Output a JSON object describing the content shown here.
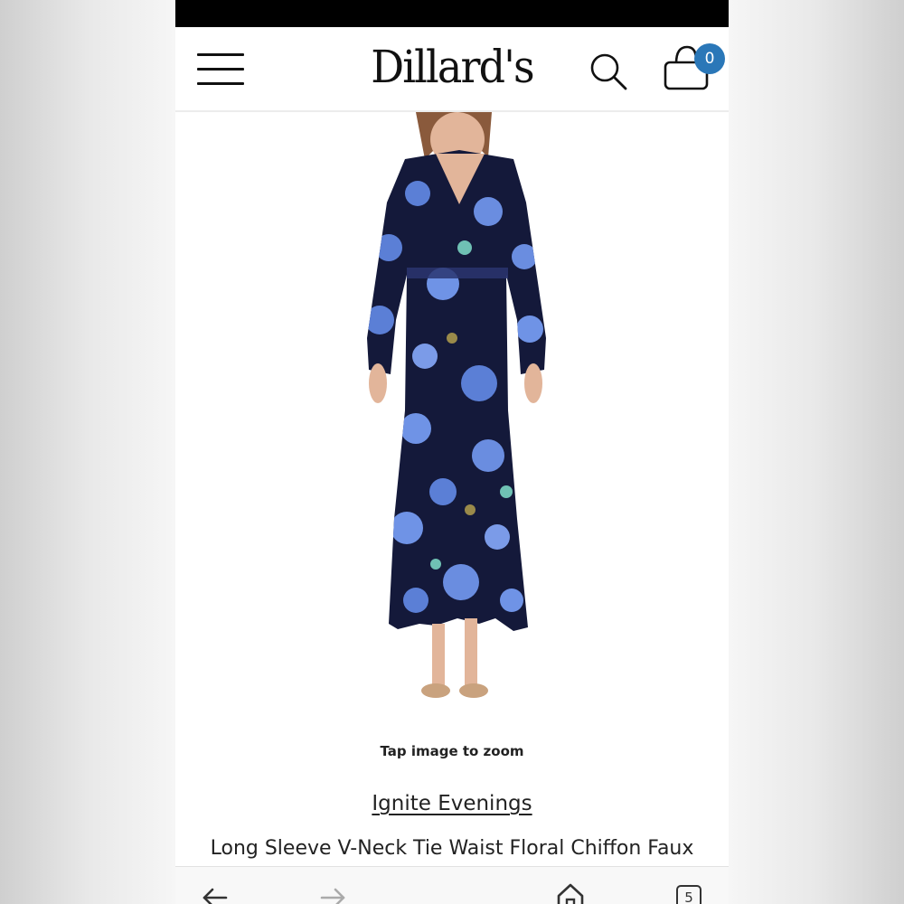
{
  "header": {
    "logo_text": "Dillard's",
    "cart_count": "0"
  },
  "product": {
    "image_hint": "Tap image to zoom",
    "brand": "Ignite Evenings",
    "title": "Long Sleeve V-Neck Tie Waist Floral Chiffon Faux"
  },
  "browser_toolbar": {
    "tab_count": "5"
  },
  "colors": {
    "accent_badge": "#2a77b8",
    "dress_navy": "#14193a",
    "flower_blue": "#5b7fd6"
  },
  "icons": [
    "menu-icon",
    "search-icon",
    "shopping-bag-icon",
    "back-arrow-icon",
    "forward-arrow-icon",
    "home-icon",
    "tabs-icon"
  ]
}
